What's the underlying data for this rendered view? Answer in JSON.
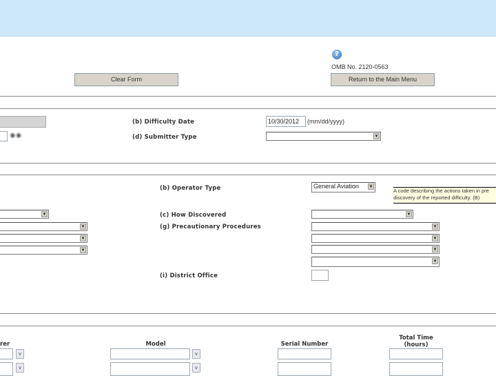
{
  "header": {
    "omb": "OMB No. 2120-0563",
    "clear_form": "Clear Form",
    "return_menu": "Return to the Main Menu",
    "help_icon": "help-icon"
  },
  "section1": {
    "difficulty_date_label": "(b) Difficulty Date",
    "difficulty_date_value": "10/30/2012",
    "date_format": "(mm/dd/yyyy)",
    "submitter_type_label": "(d) Submitter Type",
    "submitter_type_value": ""
  },
  "section2": {
    "operator_type_label": "(b) Operator Type",
    "operator_type_value": "General Aviation",
    "tooltip": "A code describing the actions taken in pre discovery of the reported difficulty. (B)",
    "how_discovered_label": "(c) How Discovered",
    "precautionary_label": "(g) Precautionary Procedures",
    "district_office_label": "(i) District Office"
  },
  "section3": {
    "col_manufacturer": "rer",
    "col_model": "Model",
    "col_serial": "Serial Number",
    "col_total_time": "Total Time (hours)"
  }
}
